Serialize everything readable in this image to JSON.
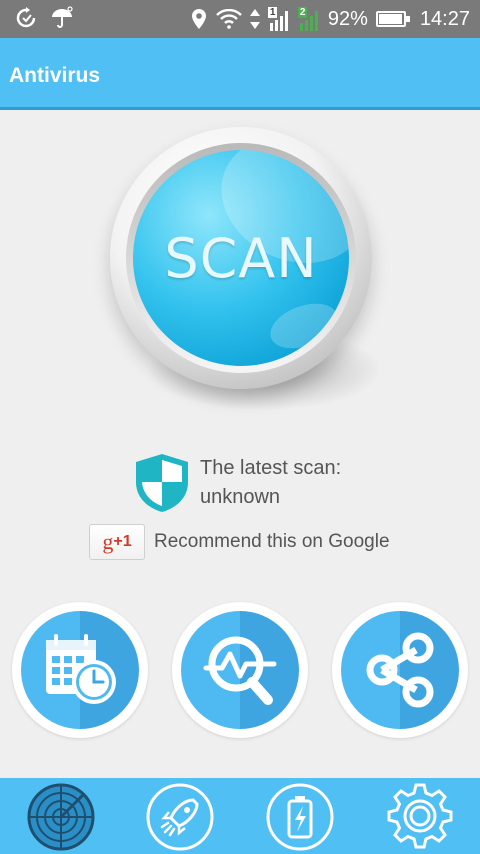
{
  "status_bar": {
    "battery": "92%",
    "time": "14:27",
    "sim1": "1",
    "sim2": "2"
  },
  "app_bar": {
    "title": "Antivirus"
  },
  "scan_button": {
    "label": "SCAN"
  },
  "latest_scan": {
    "line1": "The latest scan:",
    "line2": "unknown"
  },
  "recommend": {
    "badge_g": "g",
    "badge_plus": "+1",
    "text": "Recommend this on Google"
  },
  "features": [
    {
      "icon": "calendar-clock-icon"
    },
    {
      "icon": "magnifier-pulse-icon"
    },
    {
      "icon": "share-icon"
    }
  ],
  "bottom_nav": [
    {
      "icon": "radar-icon",
      "selected": true
    },
    {
      "icon": "rocket-icon"
    },
    {
      "icon": "battery-icon"
    },
    {
      "icon": "gear-icon"
    }
  ],
  "colors": {
    "accent": "#4fbff4",
    "status_bar": "#7a7a7a",
    "shield": "#1fb5c4",
    "google_red": "#d23b27"
  }
}
